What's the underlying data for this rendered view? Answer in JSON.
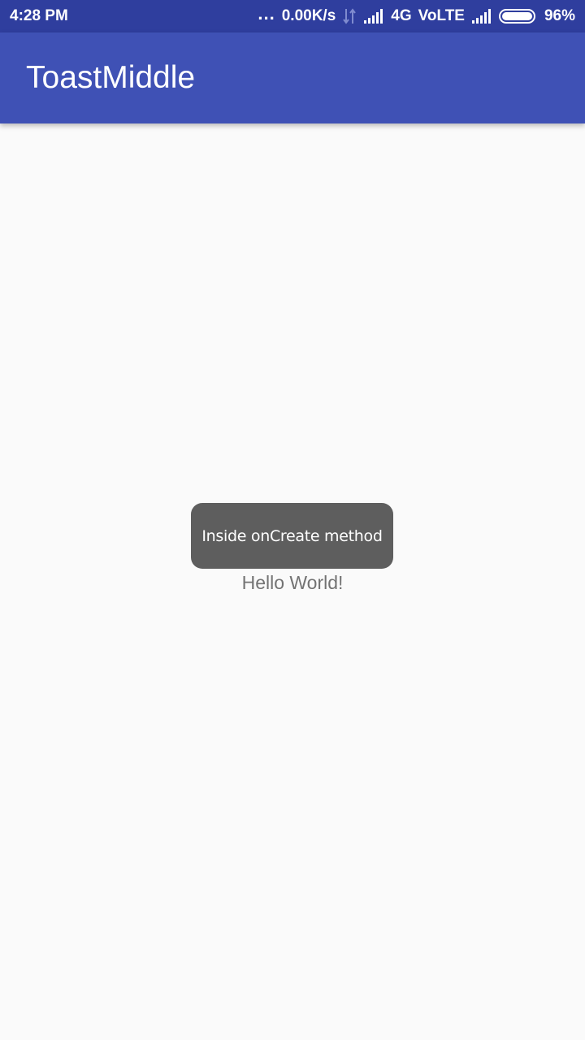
{
  "status_bar": {
    "time": "4:28 PM",
    "dots": "...",
    "net_speed": "0.00K/s",
    "network_type": "4G",
    "volte": "VoLTE",
    "battery_percent": "96%",
    "battery_level": 0.96,
    "icons": [
      "data-transfer-icon",
      "signal-icon",
      "signal-icon",
      "battery-icon"
    ]
  },
  "app_bar": {
    "title": "ToastMiddle",
    "color": "#3f51b5"
  },
  "main": {
    "hello_text": "Hello World!"
  },
  "toast": {
    "message": "Inside onCreate method",
    "color": "#5e5e5e"
  }
}
